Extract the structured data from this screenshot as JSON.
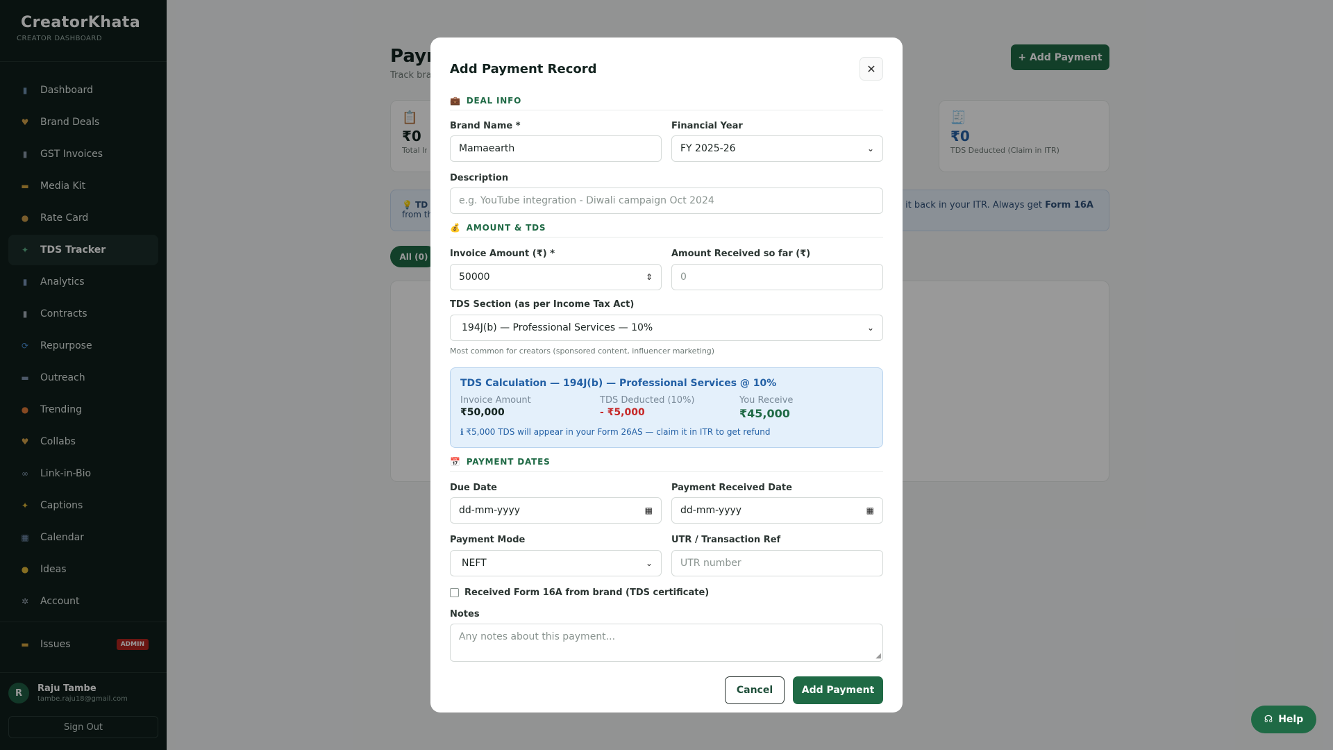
{
  "sidebar": {
    "logo": "CreatorKhata",
    "logo_sub": "CREATOR DASHBOARD",
    "items": [
      {
        "label": "Dashboard",
        "icon": "dashboard-icon",
        "glyph": "▮",
        "color": "#6f8fb0"
      },
      {
        "label": "Brand Deals",
        "icon": "handshake-icon",
        "glyph": "♥",
        "color": "#d4a24a"
      },
      {
        "label": "GST Invoices",
        "icon": "receipt-icon",
        "glyph": "▮",
        "color": "#8a9aa8"
      },
      {
        "label": "Media Kit",
        "icon": "folder-icon",
        "glyph": "▬",
        "color": "#d6a640"
      },
      {
        "label": "Rate Card",
        "icon": "money-bag-icon",
        "glyph": "●",
        "color": "#c99a4a"
      },
      {
        "label": "TDS Tracker",
        "icon": "money-wings-icon",
        "glyph": "✦",
        "color": "#5fb38a"
      },
      {
        "label": "Analytics",
        "icon": "chart-icon",
        "glyph": "▮",
        "color": "#7b95b8"
      },
      {
        "label": "Contracts",
        "icon": "document-icon",
        "glyph": "▮",
        "color": "#a7b1bb"
      },
      {
        "label": "Repurpose",
        "icon": "repeat-icon",
        "glyph": "⟳",
        "color": "#4b8fd6"
      },
      {
        "label": "Outreach",
        "icon": "mail-icon",
        "glyph": "▬",
        "color": "#7f93ad"
      },
      {
        "label": "Trending",
        "icon": "fire-icon",
        "glyph": "●",
        "color": "#e07a3a"
      },
      {
        "label": "Collabs",
        "icon": "heart-icon",
        "glyph": "♥",
        "color": "#d4a24a"
      },
      {
        "label": "Link-in-Bio",
        "icon": "link-icon",
        "glyph": "∞",
        "color": "#8aa0b6"
      },
      {
        "label": "Captions",
        "icon": "sparkle-icon",
        "glyph": "✦",
        "color": "#e0b83a"
      },
      {
        "label": "Calendar",
        "icon": "calendar-icon",
        "glyph": "▦",
        "color": "#7b95b8"
      },
      {
        "label": "Ideas",
        "icon": "bulb-icon",
        "glyph": "●",
        "color": "#e0b83a"
      },
      {
        "label": "Account",
        "icon": "gear-icon",
        "glyph": "✲",
        "color": "#9aa6b2"
      }
    ],
    "issues": {
      "label": "Issues",
      "badge": "ADMIN"
    },
    "user": {
      "initial": "R",
      "name": "Raju Tambe",
      "email": "tambe.raju18@gmail.com"
    },
    "signout": "Sign Out"
  },
  "background": {
    "title": "Paym",
    "subtitle": "Track bra",
    "add_button": "+ Add Payment",
    "card_left": {
      "value": "₹0",
      "label": "Total Inv"
    },
    "card_right": {
      "value": "₹0",
      "label": "TDS Deducted (Claim in ITR)"
    },
    "tip_left": "💡 TD",
    "tip_left2": "from th",
    "tip_right_text": "claim it back in your ITR. Always get ",
    "tip_right_bold": "Form 16A",
    "filter_all": "All (0)"
  },
  "modal": {
    "title": "Add Payment Record",
    "sections": {
      "deal": "DEAL INFO",
      "amount": "AMOUNT & TDS",
      "dates": "PAYMENT DATES"
    },
    "brand_name": {
      "label": "Brand Name *",
      "value": "Mamaearth"
    },
    "financial_year": {
      "label": "Financial Year",
      "value": "FY 2025-26"
    },
    "description": {
      "label": "Description",
      "placeholder": "e.g. YouTube integration - Diwali campaign Oct 2024"
    },
    "invoice_amount": {
      "label": "Invoice Amount (₹) *",
      "value": "50000"
    },
    "amount_received": {
      "label": "Amount Received so far (₹)",
      "placeholder": "0"
    },
    "tds_section": {
      "label": "TDS Section (as per Income Tax Act)",
      "value": "194J(b) — Professional Services — 10%",
      "hint": "Most common for creators (sponsored content, influencer marketing)"
    },
    "calc": {
      "title": "TDS Calculation — 194J(b) — Professional Services @ 10%",
      "invoice_label": "Invoice Amount",
      "invoice_value": "₹50,000",
      "tds_label": "TDS Deducted (10%)",
      "tds_value": "- ₹5,000",
      "receive_label": "You Receive",
      "receive_value": "₹45,000",
      "note": "ℹ ₹5,000 TDS will appear in your Form 26AS — claim it in ITR to get refund"
    },
    "due_date": {
      "label": "Due Date",
      "placeholder": "dd-mm-yyyy"
    },
    "received_date": {
      "label": "Payment Received Date",
      "placeholder": "dd-mm-yyyy"
    },
    "payment_mode": {
      "label": "Payment Mode",
      "value": "NEFT"
    },
    "utr": {
      "label": "UTR / Transaction Ref",
      "placeholder": "UTR number"
    },
    "form16a": "Received Form 16A from brand (TDS certificate)",
    "notes": {
      "label": "Notes",
      "placeholder": "Any notes about this payment..."
    },
    "cancel": "Cancel",
    "submit": "Add Payment"
  },
  "help": "Help"
}
